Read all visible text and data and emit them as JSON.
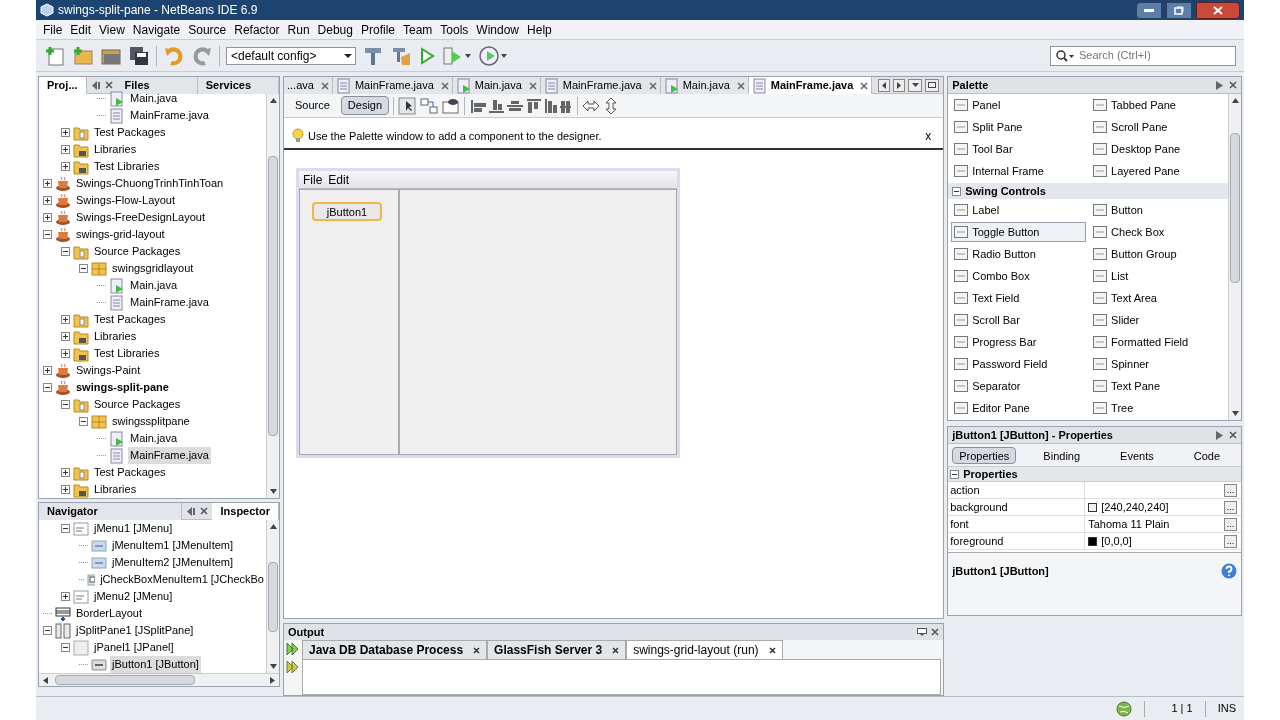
{
  "window": {
    "title": "swings-split-pane - NetBeans IDE 6.9"
  },
  "menu": [
    "File",
    "Edit",
    "View",
    "Navigate",
    "Source",
    "Refactor",
    "Run",
    "Debug",
    "Profile",
    "Team",
    "Tools",
    "Window",
    "Help"
  ],
  "toolbar": {
    "config": "<default config>",
    "search_placeholder": "Search (Ctrl+I)"
  },
  "projects_panel": {
    "tabs": [
      {
        "label": "Proj...",
        "selected": true
      },
      {
        "label": "Files",
        "selected": false
      },
      {
        "label": "Services",
        "selected": false
      }
    ],
    "tree": [
      {
        "children": [
          {
            "children": [
              {
                "children": [
                  {
                    "label": "Main.java",
                    "kind": "main",
                    "selected": false
                  },
                  {
                    "label": "MainFrame.java",
                    "kind": "form",
                    "selected": false
                  }
                ]
              }
            ]
          },
          {
            "label": "Test Packages",
            "kind": "test",
            "expanded": false,
            "selected": false
          },
          {
            "label": "Libraries",
            "kind": "lib",
            "expanded": false,
            "selected": false
          },
          {
            "label": "Test Libraries",
            "kind": "lib",
            "expanded": false,
            "selected": false
          }
        ]
      },
      {
        "label": "Swings-ChuongTrinhTinhToan",
        "kind": "project",
        "expanded": false,
        "selected": false
      },
      {
        "label": "Swings-Flow-Layout",
        "kind": "project",
        "expanded": false,
        "selected": false
      },
      {
        "label": "Swings-FreeDesignLayout",
        "kind": "project",
        "expanded": false,
        "selected": false
      },
      {
        "label": "swings-grid-layout",
        "kind": "project",
        "expanded": true,
        "selected": false,
        "children": [
          {
            "label": "Source Packages",
            "kind": "src",
            "expanded": true,
            "selected": false,
            "children": [
              {
                "label": "swingsgridlayout",
                "kind": "package",
                "expanded": true,
                "selected": false,
                "children": [
                  {
                    "label": "Main.java",
                    "kind": "main",
                    "selected": false
                  },
                  {
                    "label": "MainFrame.java",
                    "kind": "form",
                    "selected": false
                  }
                ]
              }
            ]
          },
          {
            "label": "Test Packages",
            "kind": "test",
            "expanded": false,
            "selected": false
          },
          {
            "label": "Libraries",
            "kind": "lib",
            "expanded": false,
            "selected": false
          },
          {
            "label": "Test Libraries",
            "kind": "lib",
            "expanded": false,
            "selected": false
          }
        ]
      },
      {
        "label": "Swings-Paint",
        "kind": "project",
        "expanded": false,
        "selected": false
      },
      {
        "label": "swings-split-pane",
        "kind": "project",
        "main": true,
        "expanded": true,
        "selected": false,
        "children": [
          {
            "label": "Source Packages",
            "kind": "src",
            "expanded": true,
            "selected": false,
            "children": [
              {
                "label": "swingssplitpane",
                "kind": "package",
                "expanded": true,
                "selected": false,
                "children": [
                  {
                    "label": "Main.java",
                    "kind": "main",
                    "selected": false
                  },
                  {
                    "label": "MainFrame.java",
                    "kind": "form",
                    "selected": true
                  }
                ]
              }
            ]
          },
          {
            "label": "Test Packages",
            "kind": "test",
            "expanded": false,
            "selected": false
          },
          {
            "label": "Libraries",
            "kind": "lib",
            "expanded": false,
            "selected": false
          }
        ]
      }
    ]
  },
  "navigator_panel": {
    "tabs": [
      {
        "label": "Navigator",
        "selected": false
      },
      {
        "label": "Inspector",
        "selected": true
      }
    ],
    "tree": [
      {
        "children": [
          {
            "label": "jMenu1 [JMenu]",
            "kind": "menu",
            "expanded": true,
            "selected": false,
            "children": [
              {
                "label": "jMenuItem1 [JMenuItem]",
                "kind": "menuitem",
                "selected": false
              },
              {
                "label": "jMenuItem2 [JMenuItem]",
                "kind": "menuitem",
                "selected": false
              },
              {
                "label": "jCheckBoxMenuItem1 [JCheckBo",
                "kind": "checkitem",
                "selected": false
              }
            ]
          },
          {
            "label": "jMenu2 [JMenu]",
            "kind": "menu",
            "expanded": false,
            "selected": false
          }
        ]
      },
      {
        "label": "BorderLayout",
        "kind": "layout",
        "selected": false
      },
      {
        "label": "jSplitPane1 [JSplitPane]",
        "kind": "split",
        "expanded": true,
        "selected": false,
        "children": [
          {
            "label": "jPanel1 [JPanel]",
            "kind": "panel",
            "expanded": true,
            "selected": false,
            "children": [
              {
                "label": "jButton1 [JButton]",
                "kind": "button",
                "selected": true
              }
            ]
          }
        ]
      }
    ]
  },
  "editor": {
    "tabs": [
      {
        "label": "...ava",
        "kind": "none",
        "selected": false
      },
      {
        "label": "MainFrame.java",
        "kind": "form",
        "selected": false
      },
      {
        "label": "Main.java",
        "kind": "main",
        "selected": false
      },
      {
        "label": "MainFrame.java",
        "kind": "form",
        "selected": false
      },
      {
        "label": "Main.java",
        "kind": "main",
        "selected": false
      },
      {
        "label": "MainFrame.java",
        "kind": "form",
        "selected": true
      }
    ],
    "views": [
      {
        "label": "Source",
        "selected": false
      },
      {
        "label": "Design",
        "selected": true
      }
    ],
    "hint": "Use the Palette window to add a component to the designer.",
    "hint_close": "x",
    "form": {
      "menus": [
        "File",
        "Edit"
      ],
      "button": {
        "label": "jButton1",
        "selected": true
      }
    }
  },
  "palette": {
    "title": "Palette",
    "groups": [
      {
        "items": [
          {
            "label": "Panel",
            "hovered": false
          },
          {
            "label": "Tabbed Pane",
            "hovered": false
          },
          {
            "label": "Split Pane",
            "hovered": false
          },
          {
            "label": "Scroll Pane",
            "hovered": false
          },
          {
            "label": "Tool Bar",
            "hovered": false
          },
          {
            "label": "Desktop Pane",
            "hovered": false
          },
          {
            "label": "Internal Frame",
            "hovered": false
          },
          {
            "label": "Layered Pane",
            "hovered": false
          }
        ]
      },
      {
        "label": "Swing Controls",
        "expanded": true,
        "items": [
          {
            "label": "Label",
            "hovered": false
          },
          {
            "label": "Button",
            "hovered": false
          },
          {
            "label": "Toggle Button",
            "hovered": true
          },
          {
            "label": "Check Box",
            "hovered": false
          },
          {
            "label": "Radio Button",
            "hovered": false
          },
          {
            "label": "Button Group",
            "hovered": false
          },
          {
            "label": "Combo Box",
            "hovered": false
          },
          {
            "label": "List",
            "hovered": false
          },
          {
            "label": "Text Field",
            "hovered": false
          },
          {
            "label": "Text Area",
            "hovered": false
          },
          {
            "label": "Scroll Bar",
            "hovered": false
          },
          {
            "label": "Slider",
            "hovered": false
          },
          {
            "label": "Progress Bar",
            "hovered": false
          },
          {
            "label": "Formatted Field",
            "hovered": false
          },
          {
            "label": "Password Field",
            "hovered": false
          },
          {
            "label": "Spinner",
            "hovered": false
          },
          {
            "label": "Separator",
            "hovered": false
          },
          {
            "label": "Text Pane",
            "hovered": false
          },
          {
            "label": "Editor Pane",
            "hovered": false
          },
          {
            "label": "Tree",
            "hovered": false
          }
        ]
      }
    ]
  },
  "properties": {
    "title": "jButton1 [JButton] - Properties",
    "tabs": [
      {
        "label": "Properties",
        "selected": true
      },
      {
        "label": "Binding",
        "selected": false
      },
      {
        "label": "Events",
        "selected": false
      },
      {
        "label": "Code",
        "selected": false
      }
    ],
    "section": {
      "label": "Properties",
      "expanded": true
    },
    "rows": [
      {
        "name": "action",
        "button": "..."
      },
      {
        "name": "background",
        "value": "[240,240,240]",
        "color": "#f0f0f0",
        "button": "..."
      },
      {
        "name": "font",
        "value": "Tahoma 11 Plain",
        "button": "..."
      },
      {
        "name": "foreground",
        "value": "[0,0,0]",
        "color": "#000000",
        "button": "..."
      }
    ],
    "footer": "jButton1 [JButton]"
  },
  "output": {
    "title": "Output",
    "tabs": [
      {
        "label": "Java DB Database Process",
        "selected": false
      },
      {
        "label": "GlassFish Server 3",
        "selected": false
      },
      {
        "label": "swings-grid-layout (run)",
        "selected": true
      }
    ]
  },
  "status_bar": {
    "position": "1 | 1",
    "mode": "INS"
  }
}
